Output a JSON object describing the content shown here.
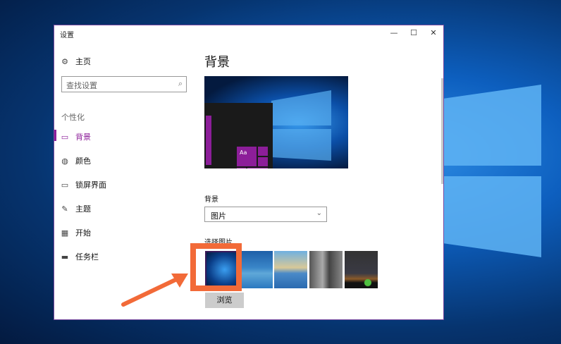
{
  "window": {
    "title": "设置",
    "minimize": "—",
    "maximize": "☐",
    "close": "✕"
  },
  "sidebar": {
    "home": "主页",
    "search_placeholder": "查找设置",
    "section": "个性化",
    "items": [
      {
        "label": "背景",
        "icon": "picture-icon",
        "active": true
      },
      {
        "label": "颜色",
        "icon": "palette-icon"
      },
      {
        "label": "锁屏界面",
        "icon": "lock-screen-icon"
      },
      {
        "label": "主题",
        "icon": "theme-icon"
      },
      {
        "label": "开始",
        "icon": "start-icon"
      },
      {
        "label": "任务栏",
        "icon": "taskbar-icon"
      }
    ]
  },
  "main": {
    "title": "背景",
    "preview_tile_text": "Aa",
    "background_label": "背景",
    "background_value": "图片",
    "choose_label": "选择图片",
    "browse": "浏览"
  },
  "colors": {
    "accent": "#8c1e99",
    "highlight": "#f26a38"
  }
}
